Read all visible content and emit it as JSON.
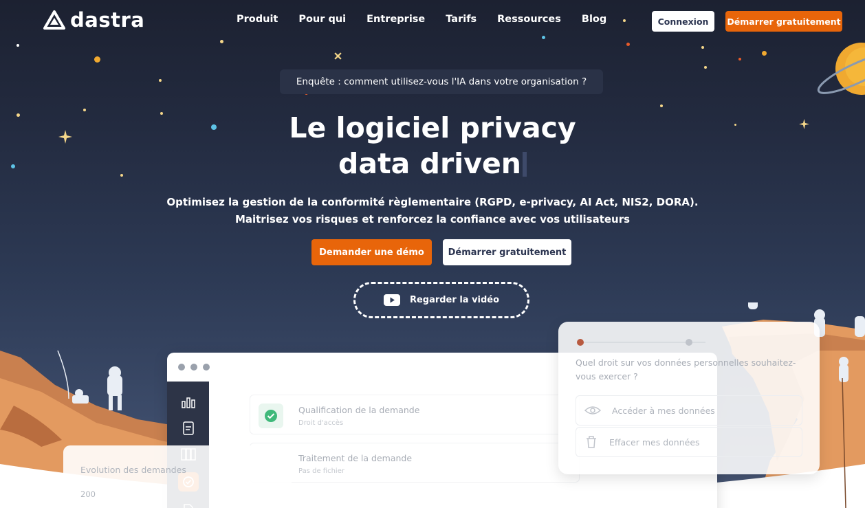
{
  "brand": {
    "name": "dastra",
    "accent": "#e8650a"
  },
  "nav": {
    "items": [
      "Produit",
      "Pour qui",
      "Entreprise",
      "Tarifs",
      "Ressources",
      "Blog"
    ],
    "login_label": "Connexion",
    "start_label": "Démarrer gratuitement"
  },
  "hero": {
    "survey": "Enquête : comment utilisez-vous l'IA dans votre organisation ?",
    "title_line1": "Le logiciel privacy",
    "title_line2": "data driven",
    "subtitle_line1": "Optimisez la gestion de la conformité règlementaire (RGPD, e-privacy, AI Act, NIS2, DORA).",
    "subtitle_line2": "Maitrisez vos risques et renforcez la confiance avec vos utilisateurs",
    "demo_label": "Demander une démo",
    "start_label": "Démarrer gratuitement",
    "video_label": "Regarder la vidéo"
  },
  "mockup": {
    "steps": [
      {
        "title": "Qualification de la demande",
        "sub": "Droit d'accès"
      },
      {
        "title": "Traitement de la demande",
        "sub": "Pas de fichier"
      }
    ],
    "rights_question": "Quel droit sur vos données personnelles souhaitez-vous exercer ?",
    "options": [
      "Accéder à mes données",
      "Effacer mes données"
    ],
    "chart_title": "Evolution des demandes",
    "chart_tick": "200"
  }
}
